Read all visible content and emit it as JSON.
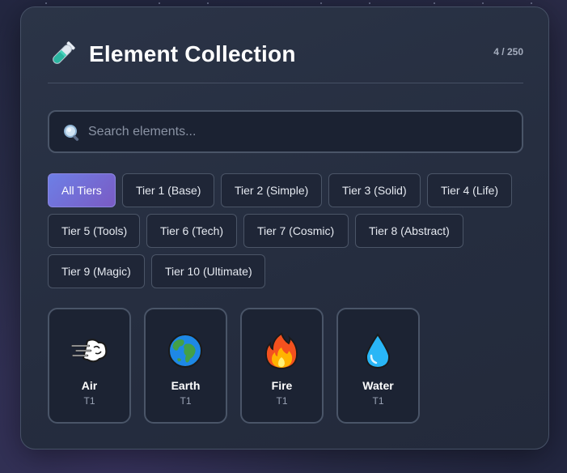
{
  "header": {
    "title": "Element Collection",
    "count": "4 / 250",
    "title_icon": "test-tube-icon"
  },
  "search": {
    "placeholder": "Search elements...",
    "value": "",
    "icon": "search-icon"
  },
  "filters": [
    {
      "label": "All Tiers",
      "active": true
    },
    {
      "label": "Tier 1 (Base)",
      "active": false
    },
    {
      "label": "Tier 2 (Simple)",
      "active": false
    },
    {
      "label": "Tier 3 (Solid)",
      "active": false
    },
    {
      "label": "Tier 4 (Life)",
      "active": false
    },
    {
      "label": "Tier 5 (Tools)",
      "active": false
    },
    {
      "label": "Tier 6 (Tech)",
      "active": false
    },
    {
      "label": "Tier 7 (Cosmic)",
      "active": false
    },
    {
      "label": "Tier 8 (Abstract)",
      "active": false
    },
    {
      "label": "Tier 9 (Magic)",
      "active": false
    },
    {
      "label": "Tier 10 (Ultimate)",
      "active": false
    }
  ],
  "elements": [
    {
      "name": "Air",
      "tier": "T1",
      "icon": "wind-icon"
    },
    {
      "name": "Earth",
      "tier": "T1",
      "icon": "globe-icon"
    },
    {
      "name": "Fire",
      "tier": "T1",
      "icon": "fire-icon"
    },
    {
      "name": "Water",
      "tier": "T1",
      "icon": "droplet-icon"
    }
  ],
  "colors": {
    "accent_start": "#6d7fe6",
    "accent_end": "#7a5bc4",
    "panel": "#252d3f",
    "card": "#1c2333"
  }
}
